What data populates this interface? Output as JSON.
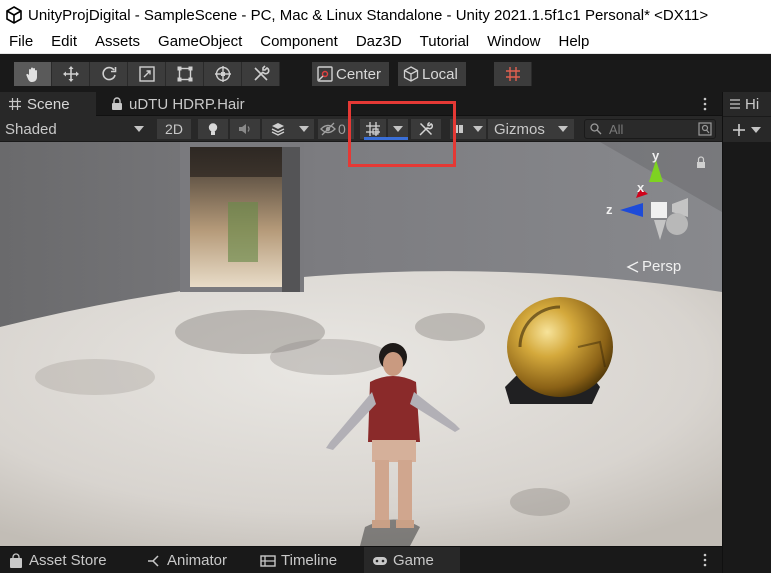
{
  "window": {
    "title": "UnityProjDigital - SampleScene - PC, Mac & Linux Standalone - Unity 2021.1.5f1c1 Personal* <DX11>"
  },
  "menu": [
    "File",
    "Edit",
    "Assets",
    "GameObject",
    "Component",
    "Daz3D",
    "Tutorial",
    "Window",
    "Help"
  ],
  "toolbar": {
    "tools": [
      "hand-tool",
      "move-tool",
      "rotate-tool",
      "scale-tool",
      "rect-tool",
      "transform-tool",
      "custom-tool"
    ],
    "pivot_label": "Center",
    "rotation_label": "Local"
  },
  "tabs": {
    "scene": "Scene",
    "udtu": "uDTU HDRP.Hair",
    "hierarchy": "Hi"
  },
  "scene_toolbar": {
    "draw_mode": "Shaded",
    "mode_2d": "2D",
    "gizmos": "Gizmos",
    "search_placeholder": "All"
  },
  "gizmo": {
    "y": "y",
    "x": "x",
    "z": "z",
    "projection": "Persp"
  },
  "bottom_tabs": {
    "asset_store": "Asset Store",
    "animator": "Animator",
    "timeline": "Timeline",
    "game": "Game"
  },
  "colors": {
    "highlight": "#e53935",
    "gizmo_y": "#7ed321",
    "gizmo_x": "#d0021b",
    "gizmo_z": "#1e4bd8"
  }
}
